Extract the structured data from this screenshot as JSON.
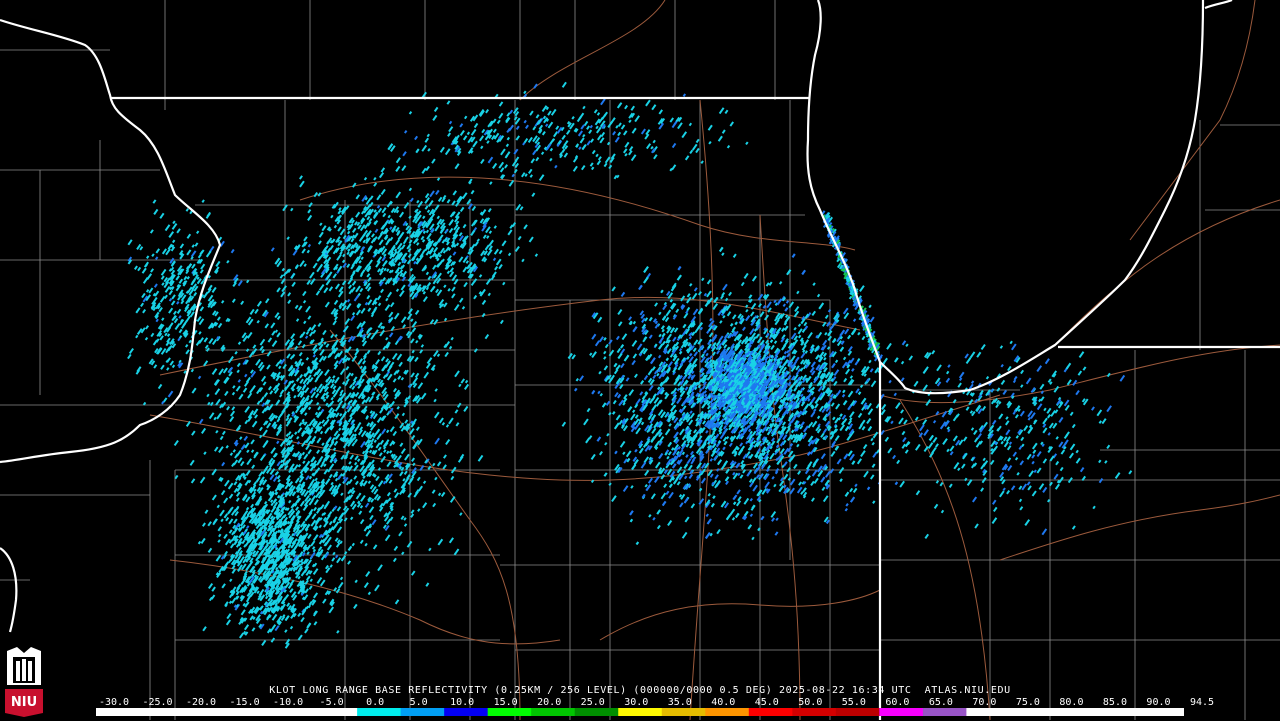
{
  "product": {
    "caption": "KLOT LONG RANGE BASE REFLECTIVITY (0.25KM / 256 LEVEL) (000000/0000 0.5 DEG) 2025-08-22 16:34 UTC  ATLAS.NIU.EDU"
  },
  "logo": {
    "text": "NIU",
    "color": "#c8102e"
  },
  "colorbar": {
    "labels": [
      "-30.0",
      "-25.0",
      "-20.0",
      "-15.0",
      "-10.0",
      "-5.0",
      "0.0",
      "5.0",
      "10.0",
      "15.0",
      "20.0",
      "25.0",
      "30.0",
      "35.0",
      "40.0",
      "45.0",
      "50.0",
      "55.0",
      "60.0",
      "65.0",
      "70.0",
      "75.0",
      "80.0",
      "85.0",
      "90.0",
      "94.5"
    ],
    "colors": [
      "#ffffff",
      "#ffffff",
      "#ffffff",
      "#ffffff",
      "#ffffff",
      "#ffffff",
      "#00ecec",
      "#019ff4",
      "#0300f4",
      "#02fd02",
      "#01c501",
      "#008e00",
      "#fdf802",
      "#e5bc00",
      "#fd9500",
      "#fd0000",
      "#d40000",
      "#bc0000",
      "#f800fd",
      "#9854c6",
      "#fdfdfd",
      "#fdfdfd",
      "#fdfdfd",
      "#fdfdfd",
      "#fdfdfd"
    ]
  },
  "map_colors": {
    "state_border": "#ffffff",
    "county_line": "#8c8c8c",
    "highway": "#9c5a3c",
    "echo_light": "#19d2e6",
    "echo_mid": "#1e78f0",
    "echo_strong": "#14c850"
  }
}
